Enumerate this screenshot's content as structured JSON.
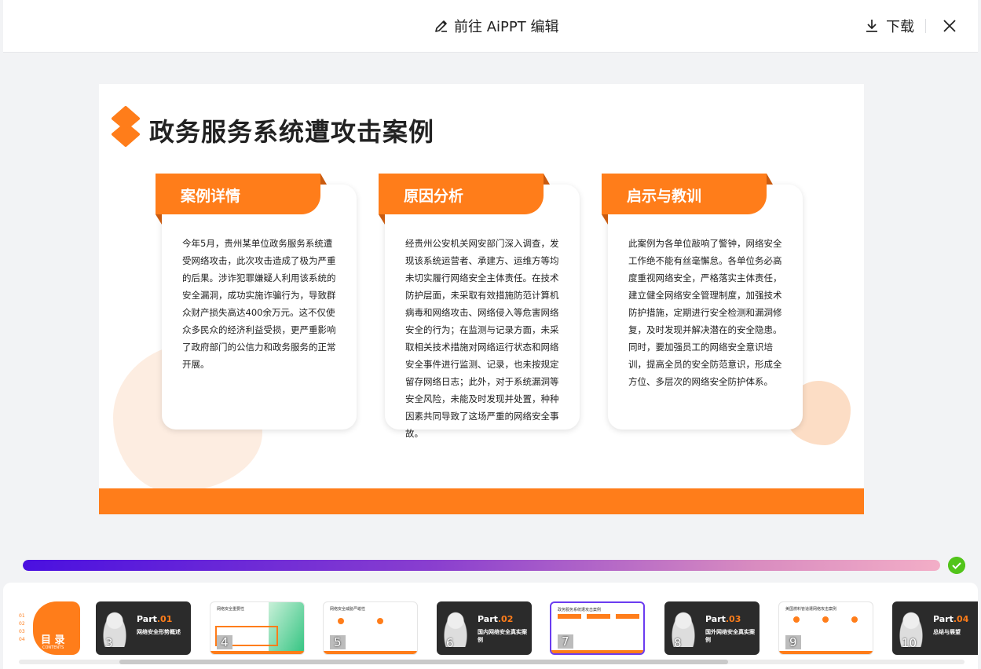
{
  "header": {
    "edit_label": "前往 AiPPT 编辑",
    "download_label": "下载"
  },
  "slide": {
    "title": "政务服务系统遭攻击案例",
    "cards": [
      {
        "heading": "案例详情",
        "text": "今年5月，贵州某单位政务服务系统遭受网络攻击，此次攻击造成了极为严重的后果。涉诈犯罪嫌疑人利用该系统的安全漏洞，成功实施诈骗行为，导致群众财产损失高达400余万元。这不仅使众多民众的经济利益受损，更严重影响了政府部门的公信力和政务服务的正常开展。"
      },
      {
        "heading": "原因分析",
        "text": "经贵州公安机关网安部门深入调查，发现该系统运营者、承建方、运维方等均未切实履行网络安全主体责任。在技术防护层面，未采取有效措施防范计算机病毒和网络攻击、网络侵入等危害网络安全的行为；在监测与记录方面，未采取相关技术措施对网络运行状态和网络安全事件进行监测、记录，也未按规定留存网络日志；此外，对于系统漏洞等安全风险，未能及时发现并处置，种种因素共同导致了这场严重的网络安全事故。"
      },
      {
        "heading": "启示与教训",
        "text": "此案例为各单位敲响了警钟，网络安全工作绝不能有丝毫懈怠。各单位务必高度重视网络安全，严格落实主体责任，建立健全网络安全管理制度，加强技术防护措施，定期进行安全检测和漏洞修复，及时发现并解决潜在的安全隐患。同时，要加强员工的网络安全意识培训，提高全员的安全防范意识，形成全方位、多层次的网络安全防护体系。"
      }
    ]
  },
  "progress": {
    "value": 1.0,
    "status": "complete"
  },
  "thumbnails": {
    "first": {
      "title": "目 录",
      "subtitle": "CONTENTS",
      "items": [
        "01",
        "02",
        "03",
        "04"
      ]
    },
    "items": [
      {
        "num": "3",
        "style": "dark",
        "part_prefix": "Part",
        "part_num": ".01",
        "subtitle": "网络安全形势概述"
      },
      {
        "num": "4",
        "style": "light",
        "mini_title": "网络安全重要性"
      },
      {
        "num": "5",
        "style": "light",
        "mini_title": "网络安全威胁严峻性"
      },
      {
        "num": "6",
        "style": "dark",
        "part_prefix": "Part",
        "part_num": ".02",
        "subtitle": "国内网络安全真实案例"
      },
      {
        "num": "7",
        "style": "light",
        "selected": true,
        "mini_title": "政务服务系统遭攻击案例"
      },
      {
        "num": "8",
        "style": "dark",
        "part_prefix": "Part",
        "part_num": ".03",
        "subtitle": "国外网络安全真实案例"
      },
      {
        "num": "9",
        "style": "light",
        "mini_title": "美国燃料管道遭网络攻击案例"
      },
      {
        "num": "10",
        "style": "dark",
        "part_prefix": "Part",
        "part_num": ".04",
        "subtitle": "总结与展望"
      }
    ]
  },
  "colors": {
    "accent": "#ff7d1a",
    "selected": "#6b3cf0",
    "success": "#52c41a"
  }
}
